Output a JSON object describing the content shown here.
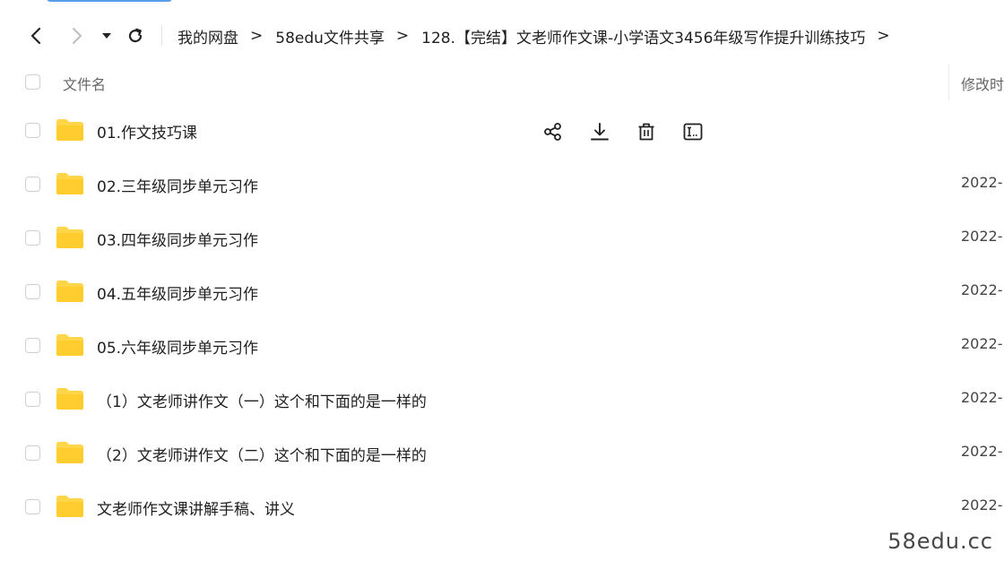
{
  "breadcrumb": [
    "我的网盘",
    "58edu文件共享",
    "128.【完结】文老师作文课-小学语文3456年级写作提升训练技巧"
  ],
  "breadcrumb_separator": ">",
  "header": {
    "name_label": "文件名",
    "mtime_label": "修改时"
  },
  "files": [
    {
      "name": "01.作文技巧课",
      "date": ""
    },
    {
      "name": "02.三年级同步单元习作",
      "date": "2022-"
    },
    {
      "name": "03.四年级同步单元习作",
      "date": "2022-"
    },
    {
      "name": "04.五年级同步单元习作",
      "date": "2022-"
    },
    {
      "name": "05.六年级同步单元习作",
      "date": "2022-"
    },
    {
      "name": "（1）文老师讲作文（一）这个和下面的是一样的",
      "date": "2022-"
    },
    {
      "name": "（2）文老师讲作文（二）这个和下面的是一样的",
      "date": "2022-"
    },
    {
      "name": "文老师作文课讲解手稿、讲义",
      "date": "2022-"
    }
  ],
  "icons": {
    "folder_color": "#ffd54a",
    "accent": "#3a8ee6"
  },
  "watermark": "58edu.cc"
}
